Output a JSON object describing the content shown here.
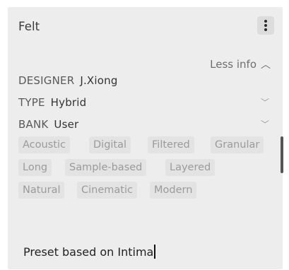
{
  "preset": {
    "name": "Felt",
    "less_info_label": "Less info",
    "designer_key": "DESIGNER",
    "designer": "J.Xiong",
    "type_key": "TYPE",
    "type": "Hybrid",
    "bank_key": "BANK",
    "bank": "User",
    "tags": [
      "Acoustic",
      "Digital",
      "Filtered",
      "Granular",
      "Long",
      "Sample-based",
      "Layered",
      "Natural",
      "Cinematic",
      "Modern"
    ],
    "description": "Preset based on Intima"
  },
  "icons": {
    "menu": "kebab-menu-icon",
    "collapse": "chevron-up-icon",
    "dropdown": "chevron-down-icon"
  }
}
